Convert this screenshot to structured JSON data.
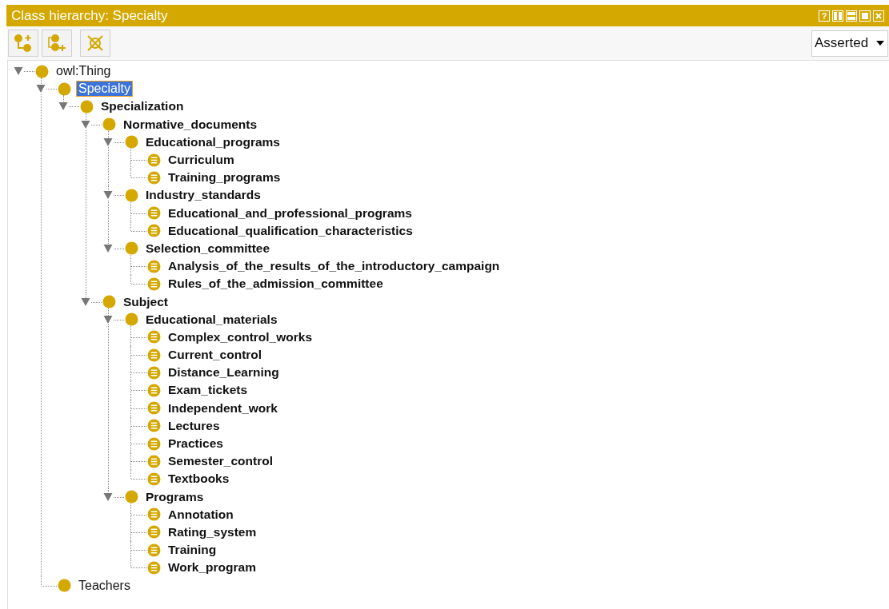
{
  "window": {
    "title": "Class hierarchy: Specialty",
    "help_button": "?"
  },
  "toolbar": {
    "view_select": {
      "value": "Asserted"
    }
  },
  "tree": [
    {
      "label": "owl:Thing",
      "kind": "class",
      "bold": false,
      "selected": false,
      "expanded": true,
      "children": [
        {
          "label": "Specialty",
          "kind": "class",
          "bold": false,
          "selected": true,
          "expanded": true,
          "children": [
            {
              "label": "Specialization",
              "kind": "class",
              "bold": true,
              "selected": false,
              "expanded": true,
              "children": [
                {
                  "label": "Normative_documents",
                  "kind": "class",
                  "bold": true,
                  "selected": false,
                  "expanded": true,
                  "children": [
                    {
                      "label": "Educational_programs",
                      "kind": "class",
                      "bold": true,
                      "selected": false,
                      "expanded": true,
                      "children": [
                        {
                          "label": "Curriculum",
                          "kind": "defined",
                          "bold": true,
                          "selected": false
                        },
                        {
                          "label": "Training_programs",
                          "kind": "defined",
                          "bold": true,
                          "selected": false
                        }
                      ]
                    },
                    {
                      "label": "Industry_standards",
                      "kind": "class",
                      "bold": true,
                      "selected": false,
                      "expanded": true,
                      "children": [
                        {
                          "label": "Educational_and_professional_programs",
                          "kind": "defined",
                          "bold": true,
                          "selected": false
                        },
                        {
                          "label": "Educational_qualification_characteristics",
                          "kind": "defined",
                          "bold": true,
                          "selected": false
                        }
                      ]
                    },
                    {
                      "label": "Selection_committee",
                      "kind": "class",
                      "bold": true,
                      "selected": false,
                      "expanded": true,
                      "children": [
                        {
                          "label": "Analysis_of_the_results_of_the_introductory_campaign",
                          "kind": "defined",
                          "bold": true,
                          "selected": false
                        },
                        {
                          "label": "Rules_of_the_admission_committee",
                          "kind": "defined",
                          "bold": true,
                          "selected": false
                        }
                      ]
                    }
                  ]
                },
                {
                  "label": "Subject",
                  "kind": "class",
                  "bold": true,
                  "selected": false,
                  "expanded": true,
                  "children": [
                    {
                      "label": "Educational_materials",
                      "kind": "class",
                      "bold": true,
                      "selected": false,
                      "expanded": true,
                      "children": [
                        {
                          "label": "Complex_control_works",
                          "kind": "defined",
                          "bold": true,
                          "selected": false
                        },
                        {
                          "label": "Current_control",
                          "kind": "defined",
                          "bold": true,
                          "selected": false
                        },
                        {
                          "label": "Distance_Learning",
                          "kind": "defined",
                          "bold": true,
                          "selected": false
                        },
                        {
                          "label": "Exam_tickets",
                          "kind": "defined",
                          "bold": true,
                          "selected": false
                        },
                        {
                          "label": "Independent_work",
                          "kind": "defined",
                          "bold": true,
                          "selected": false
                        },
                        {
                          "label": "Lectures",
                          "kind": "defined",
                          "bold": true,
                          "selected": false
                        },
                        {
                          "label": "Practices",
                          "kind": "defined",
                          "bold": true,
                          "selected": false
                        },
                        {
                          "label": "Semester_control",
                          "kind": "defined",
                          "bold": true,
                          "selected": false
                        },
                        {
                          "label": "Textbooks",
                          "kind": "defined",
                          "bold": true,
                          "selected": false
                        }
                      ]
                    },
                    {
                      "label": "Programs",
                      "kind": "class",
                      "bold": true,
                      "selected": false,
                      "expanded": true,
                      "children": [
                        {
                          "label": "Annotation",
                          "kind": "defined",
                          "bold": true,
                          "selected": false
                        },
                        {
                          "label": "Rating_system",
                          "kind": "defined",
                          "bold": true,
                          "selected": false
                        },
                        {
                          "label": "Training",
                          "kind": "defined",
                          "bold": true,
                          "selected": false
                        },
                        {
                          "label": "Work_program",
                          "kind": "defined",
                          "bold": true,
                          "selected": false
                        }
                      ]
                    }
                  ]
                }
              ]
            }
          ]
        },
        {
          "label": "Teachers",
          "kind": "class",
          "bold": false,
          "selected": false
        }
      ]
    }
  ]
}
